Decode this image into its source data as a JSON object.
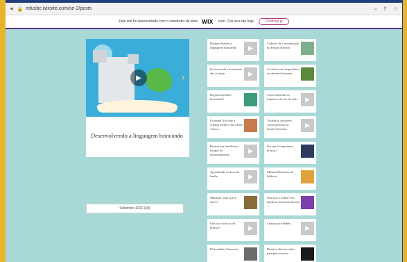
{
  "browser": {
    "url": "edusbc.wixsite.com/se-2/posts"
  },
  "banner": {
    "text": "Este site foi desenvolvido com o construtor de sites",
    "logo": "WIX",
    "text2": ".com. Crie seu site hoje.",
    "cta": "Conheça já"
  },
  "featured": {
    "title": "Desenvolvendo a linguagem brincando"
  },
  "archive": {
    "label": "Setembro 2021 (18)"
  },
  "posts": [
    {
      "title": "Desenvolvendo a linguagem brincando",
      "thumb": "video",
      "color": "#c9c9c9"
    },
    {
      "title": "Caderno de Comunicação no Ensino Híbrido",
      "thumb": "image",
      "color": "#7fae8b"
    },
    {
      "title": "Promovendo a autonomia das crianças",
      "thumb": "video",
      "color": "#c9c9c9"
    },
    {
      "title": "A música tem importância no desenvolvimento ...",
      "thumb": "image",
      "color": "#5c8a3c"
    },
    {
      "title": "Há para aprender brincando?",
      "thumb": "image",
      "color": "#3b9c7a"
    },
    {
      "title": "Como diminuir os impactos do uso de telas",
      "thumb": "video",
      "color": "#c9c9c9"
    },
    {
      "title": "Eu menti! Por que a criança mente e faz várias vezes a...",
      "thumb": "image",
      "color": "#c77a4c"
    },
    {
      "title": "Violência, possíveis consequências no desenvolviment...",
      "thumb": "video",
      "color": "#c9c9c9"
    },
    {
      "title": "Brincar em família em tempos de distanciamento...",
      "thumb": "video",
      "color": "#c9c9c9"
    },
    {
      "title": "Por que é importante brincar?",
      "thumb": "image",
      "color": "#2d3b5c"
    },
    {
      "title": "Aprendendo na hora do banho",
      "thumb": "video",
      "color": "#c9c9c9"
    },
    {
      "title": "Minhas Memórias de Infância",
      "thumb": "image",
      "color": "#e0a23a"
    },
    {
      "title": "Mastigar: para que te quero?",
      "thumb": "image",
      "color": "#8a6b3a"
    },
    {
      "title": "Para que a rotina? Ela ajuda no desenvolvimento ...",
      "thumb": "image",
      "color": "#7a3fa8"
    },
    {
      "title": "Eles são curiosos de brincar?",
      "thumb": "video",
      "color": "#c9c9c9"
    },
    {
      "title": "Leitura para Bebês",
      "thumb": "video",
      "color": "#c9c9c9"
    },
    {
      "title": "Dificuldade Alimentar",
      "thumb": "image",
      "color": "#6b6b6b"
    },
    {
      "title": "Direitos diferenciados para pessoa com...",
      "thumb": "image",
      "color": "#1a1a1a"
    }
  ]
}
